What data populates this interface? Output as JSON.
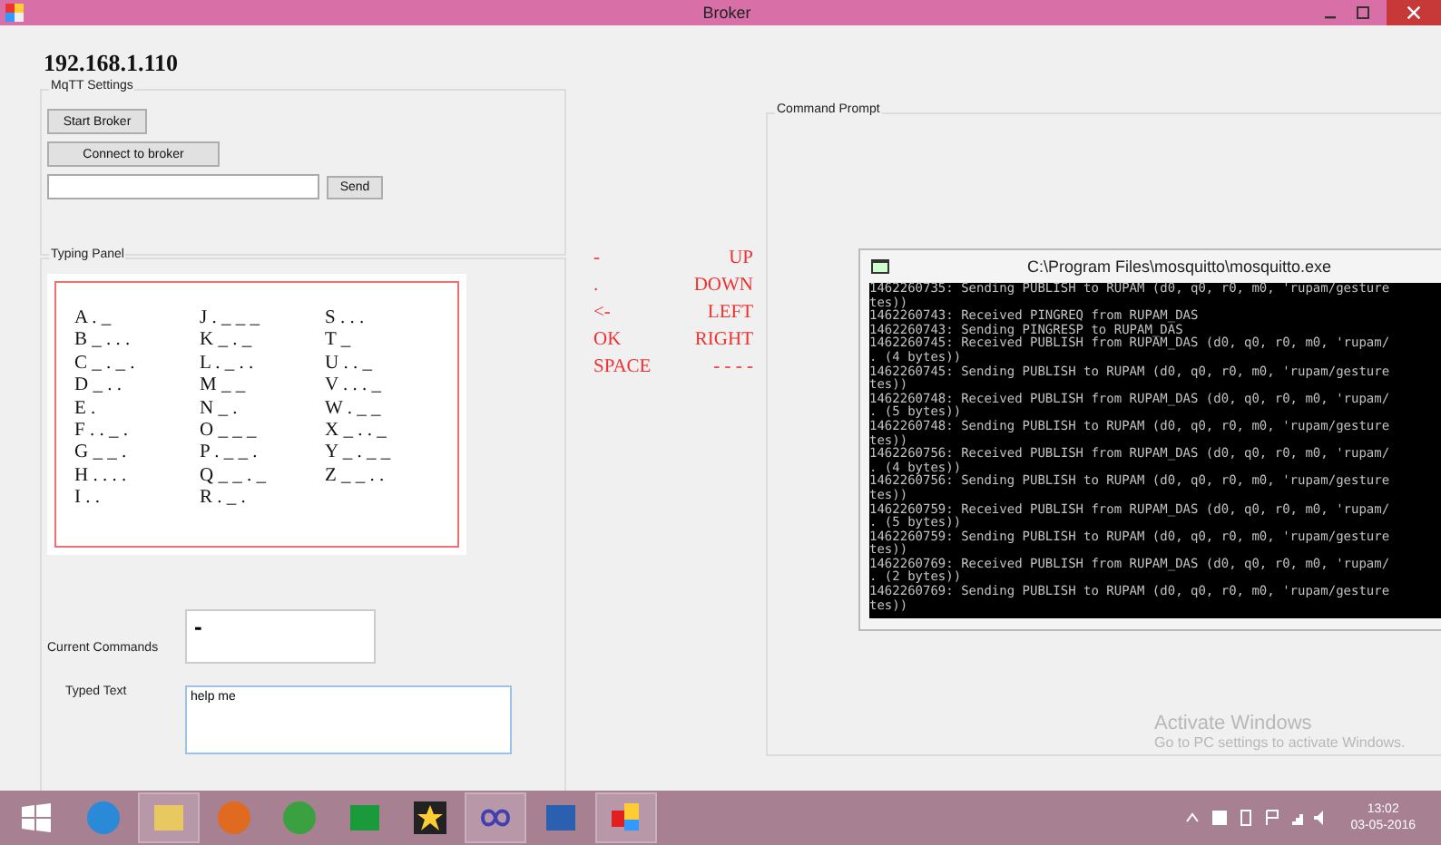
{
  "window": {
    "title": "Broker"
  },
  "ip_address": "192.168.1.110",
  "mqtt_settings": {
    "title": "MqTT Settings",
    "buttons": [
      "Start Broker",
      "Connect to broker"
    ],
    "send_button": "Send"
  },
  "typing_panel": {
    "title": "Typing Panel",
    "columns": [
      [
        "A . _",
        "B _ . . .",
        "C _ . _ .",
        "D _ . .",
        "E .",
        "F . . _ .",
        "G _ _ .",
        "H . . . .",
        "I . ."
      ],
      [
        "J . _ _ _",
        "K _ . _",
        "L . _ . .",
        "M _ _",
        "N _ .",
        "O _ _ _",
        "P . _ _ .",
        "Q _ _ . _",
        "R . _ ."
      ],
      [
        "S . . .",
        "T _",
        "U . . _",
        "V . . . _",
        "W . _ _",
        "X _ . . _",
        "Y _ . _ _",
        "Z _ _ . ."
      ]
    ]
  },
  "command_legend": [
    {
      "symbol": "-",
      "action": "UP"
    },
    {
      "symbol": ".",
      "action": "DOWN"
    },
    {
      "symbol": "<-",
      "action": "LEFT"
    },
    {
      "symbol": "OK",
      "action": "RIGHT"
    },
    {
      "symbol": "SPACE",
      "action": "- - - -"
    }
  ],
  "current_commands": {
    "label": "Current Commands",
    "value": "-"
  },
  "typed_text": {
    "label": "Typed Text",
    "value": "help me"
  },
  "command_prompt": {
    "title": "Command Prompt"
  },
  "console": {
    "title": "C:\\Program Files\\mosquitto\\mosquitto.exe",
    "lines": [
      "1462260735: Sending PUBLISH to RUPAM (d0, q0, r0, m0, 'rupam/gesture",
      "tes))",
      "1462260743: Received PINGREQ from RUPAM_DAS",
      "1462260743: Sending PINGRESP to RUPAM_DAS",
      "1462260745: Received PUBLISH from RUPAM_DAS (d0, q0, r0, m0, 'rupam/",
      ". (4 bytes))",
      "1462260745: Sending PUBLISH to RUPAM (d0, q0, r0, m0, 'rupam/gesture",
      "tes))",
      "1462260748: Received PUBLISH from RUPAM_DAS (d0, q0, r0, m0, 'rupam/",
      ". (5 bytes))",
      "1462260748: Sending PUBLISH to RUPAM (d0, q0, r0, m0, 'rupam/gesture",
      "tes))",
      "1462260756: Received PUBLISH from RUPAM_DAS (d0, q0, r0, m0, 'rupam/",
      ". (4 bytes))",
      "1462260756: Sending PUBLISH to RUPAM (d0, q0, r0, m0, 'rupam/gesture",
      "tes))",
      "1462260759: Received PUBLISH from RUPAM_DAS (d0, q0, r0, m0, 'rupam/",
      ". (5 bytes))",
      "1462260759: Sending PUBLISH to RUPAM (d0, q0, r0, m0, 'rupam/gesture",
      "tes))",
      "1462260769: Received PUBLISH from RUPAM_DAS (d0, q0, r0, m0, 'rupam/",
      ". (2 bytes))",
      "1462260769: Sending PUBLISH to RUPAM (d0, q0, r0, m0, 'rupam/gesture",
      "tes))"
    ]
  },
  "activation_notice": {
    "title": "Activate Windows",
    "text": "Go to PC settings to activate Windows."
  },
  "taskbar": {
    "apps": [
      {
        "kind": "browser-e",
        "active": false
      },
      {
        "kind": "folder",
        "active": true
      },
      {
        "kind": "fox",
        "active": false
      },
      {
        "kind": "chrome",
        "active": false
      },
      {
        "kind": "store",
        "active": false
      },
      {
        "kind": "star",
        "active": false
      },
      {
        "kind": "infinity",
        "active": true
      },
      {
        "kind": "word",
        "active": false
      },
      {
        "kind": "broker",
        "active": true
      }
    ],
    "time": "13:02",
    "date": "03-05-2016"
  }
}
